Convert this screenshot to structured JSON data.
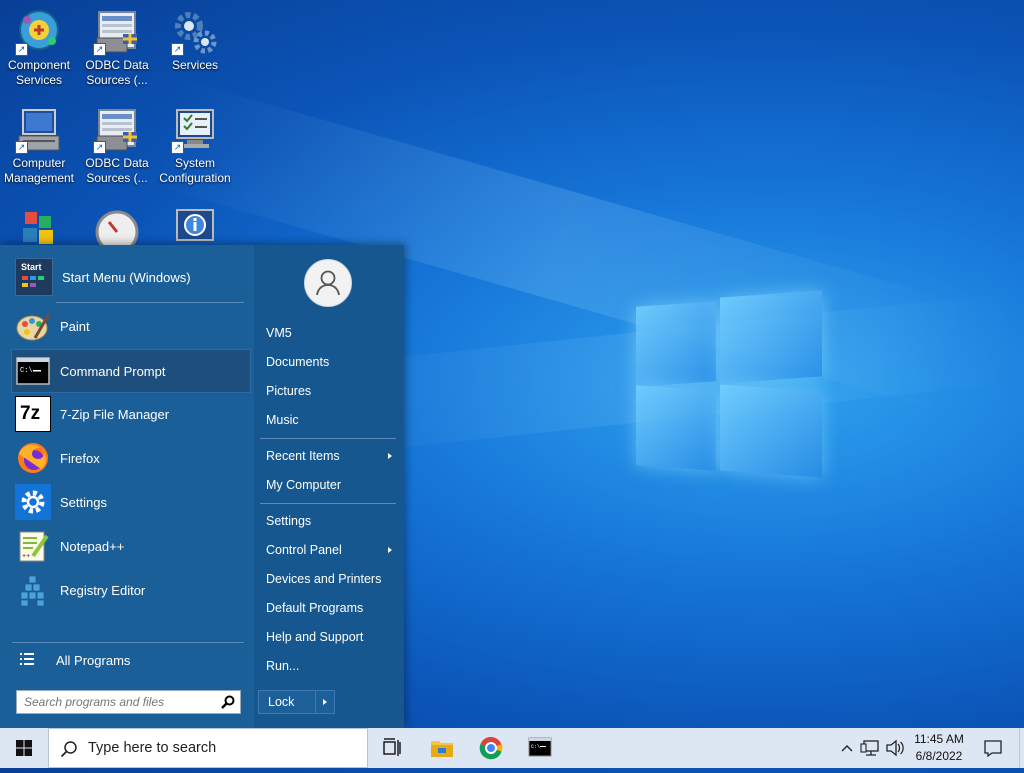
{
  "desktop": {
    "icons": [
      {
        "label_line1": "Component",
        "label_line2": "Services",
        "icon": "component-services-icon"
      },
      {
        "label_line1": "ODBC Data",
        "label_line2": "Sources (...",
        "icon": "odbc-icon"
      },
      {
        "label_line1": "Services",
        "label_line2": "",
        "icon": "gears-icon"
      },
      {
        "label_line1": "Computer",
        "label_line2": "Management",
        "icon": "computer-management-icon"
      },
      {
        "label_line1": "ODBC Data",
        "label_line2": "Sources (...",
        "icon": "odbc-icon"
      },
      {
        "label_line1": "System",
        "label_line2": "Configuration",
        "icon": "system-configuration-icon"
      }
    ]
  },
  "start_menu": {
    "header_item": {
      "label": "Start Menu (Windows)",
      "icon_text": "Start"
    },
    "pinned": [
      {
        "label": "Paint",
        "icon": "paint-icon"
      },
      {
        "label": "Command Prompt",
        "icon": "cmd-icon",
        "active": true
      },
      {
        "label": "7-Zip File Manager",
        "icon": "7zip-icon",
        "icon_text": "7z"
      },
      {
        "label": "Firefox",
        "icon": "firefox-icon"
      },
      {
        "label": "Settings",
        "icon": "gear-icon"
      },
      {
        "label": "Notepad++",
        "icon": "notepadpp-icon"
      },
      {
        "label": "Registry Editor",
        "icon": "registry-icon"
      }
    ],
    "all_programs": "All Programs",
    "search_placeholder": "Search programs and files",
    "right": {
      "user_name": "VM5",
      "documents": "Documents",
      "pictures": "Pictures",
      "music": "Music",
      "recent_items": "Recent Items",
      "my_computer": "My Computer",
      "settings": "Settings",
      "control_panel": "Control Panel",
      "devices_printers": "Devices and Printers",
      "default_programs": "Default Programs",
      "help_support": "Help and Support",
      "run": "Run...",
      "lock": "Lock"
    }
  },
  "taskbar": {
    "search_placeholder": "Type here to search",
    "time": "11:45 AM",
    "date": "6/8/2022"
  }
}
